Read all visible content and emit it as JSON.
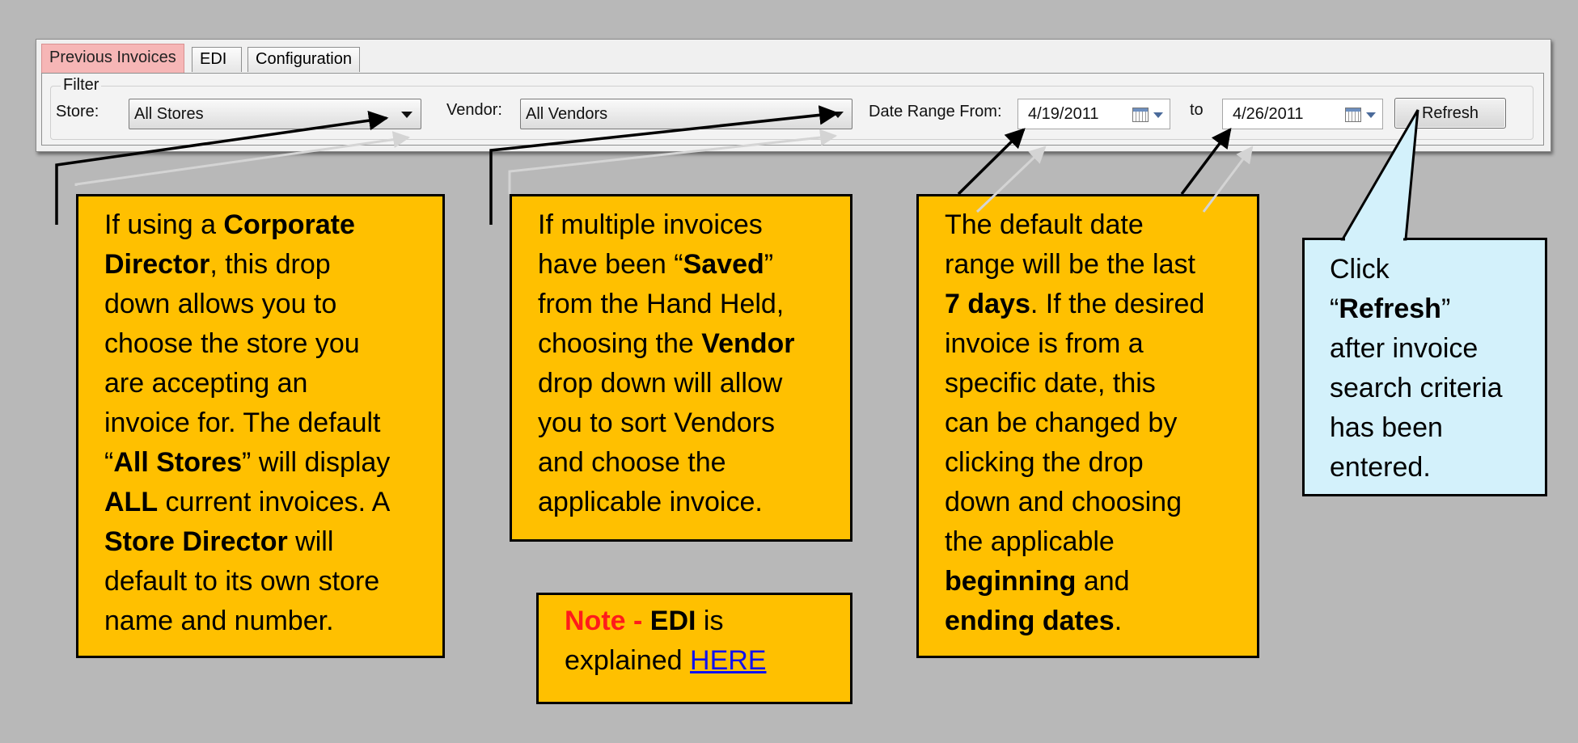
{
  "window": {
    "tabs": [
      {
        "label": "Previous Invoices",
        "active": true
      },
      {
        "label": "EDI",
        "active": false
      },
      {
        "label": "Configuration",
        "active": false
      }
    ],
    "filter": {
      "group_label": "Filter",
      "store_label": "Store:",
      "store_value": "All Stores",
      "vendor_label": "Vendor:",
      "vendor_value": "All Vendors",
      "date_range_label": "Date Range From:",
      "date_from": "4/19/2011",
      "to_label": "to",
      "date_to": "4/26/2011",
      "refresh_label": "Refresh"
    }
  },
  "callouts": {
    "store": {
      "lines": [
        [
          "If using a ",
          "Corporate"
        ],
        [
          "Director",
          ", this drop"
        ],
        [
          "down allows you to"
        ],
        [
          "choose the store you"
        ],
        [
          "are accepting an"
        ],
        [
          "invoice for. The default"
        ],
        [
          "“",
          "All Stores",
          "” will display"
        ],
        [
          "ALL",
          " current invoices. A"
        ],
        [
          "Store Director",
          " will"
        ],
        [
          "default to its own store"
        ],
        [
          "name and number."
        ]
      ]
    },
    "vendor": {
      "lines": [
        [
          "If multiple invoices"
        ],
        [
          "have been “",
          "Saved",
          "”"
        ],
        [
          "from the Hand Held,"
        ],
        [
          "choosing the ",
          "Vendor"
        ],
        [
          "drop down will allow"
        ],
        [
          "you to sort Vendors"
        ],
        [
          "and choose the"
        ],
        [
          "applicable invoice."
        ]
      ]
    },
    "note": {
      "prefix": "Note - ",
      "edi": "EDI",
      "text1": " is",
      "text2": "explained ",
      "link": "HERE"
    },
    "date": {
      "lines": [
        [
          "The default date"
        ],
        [
          "range will be the last"
        ],
        [
          "7 days",
          ". If the desired"
        ],
        [
          "invoice is from a"
        ],
        [
          "specific date, this"
        ],
        [
          "can be changed by"
        ],
        [
          "clicking the drop"
        ],
        [
          "down and choosing"
        ],
        [
          "the applicable"
        ],
        [
          "beginning",
          " and"
        ],
        [
          "ending dates",
          "."
        ]
      ]
    },
    "refresh": {
      "lines": [
        [
          "Click"
        ],
        [
          "“",
          "Refresh",
          "”"
        ],
        [
          "after invoice"
        ],
        [
          "search criteria"
        ],
        [
          "has been"
        ],
        [
          "entered."
        ]
      ]
    }
  },
  "colors": {
    "background": "#b8b8b8",
    "callout_orange": "#ffc000",
    "callout_blue": "#d3f1fb",
    "note_red": "#ff1b1b",
    "link_blue": "#1111ee"
  }
}
